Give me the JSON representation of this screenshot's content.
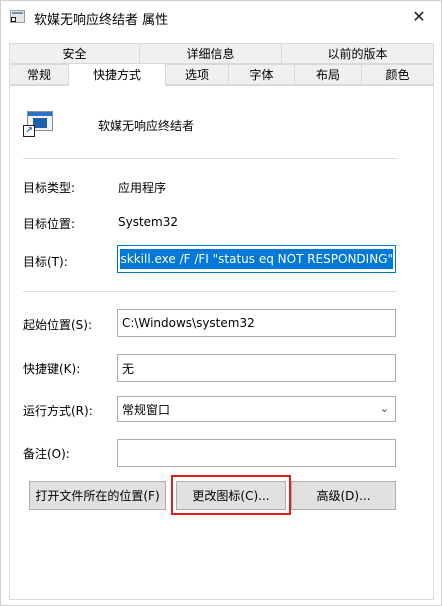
{
  "window": {
    "title": "软媒无响应终结者 属性",
    "close_glyph": "✕"
  },
  "tabs": {
    "row1": [
      "安全",
      "详细信息",
      "以前的版本"
    ],
    "row2": [
      "常规",
      "快捷方式",
      "选项",
      "字体",
      "布局",
      "颜色"
    ],
    "active": "快捷方式"
  },
  "shortcut": {
    "app_name": "软媒无响应终结者",
    "app_icon": "shortcut-app-icon",
    "target_type_label": "目标类型:",
    "target_type_value": "应用程序",
    "target_location_label": "目标位置:",
    "target_location_value": "System32",
    "target_label": "目标(T):",
    "target_value": "iskkill.exe /F /FI \"status eq NOT RESPONDING\"",
    "start_in_label": "起始位置(S):",
    "start_in_value": "C:\\Windows\\system32",
    "hotkey_label": "快捷键(K):",
    "hotkey_value": "无",
    "run_label": "运行方式(R):",
    "run_value": "常规窗口",
    "comment_label": "备注(O):",
    "comment_value": "",
    "open_location_button": "打开文件所在的位置(F)",
    "change_icon_button": "更改图标(C)...",
    "advanced_button": "高级(D)..."
  },
  "colors": {
    "selection": "#0078d7",
    "highlight_box": "#e02020"
  }
}
